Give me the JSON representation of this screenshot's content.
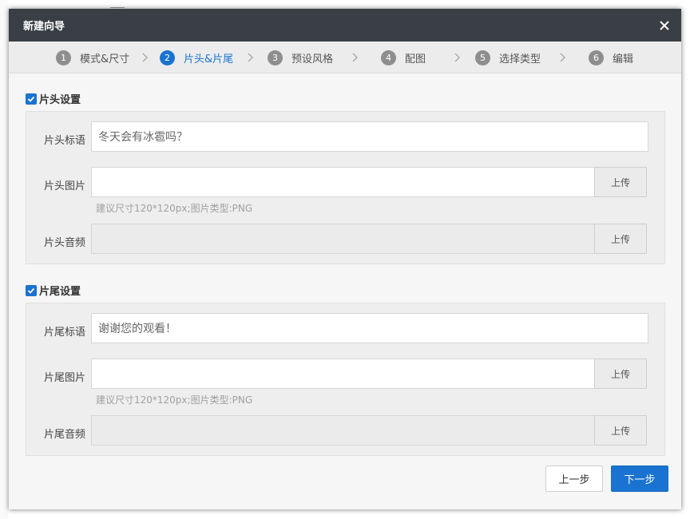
{
  "dialog": {
    "title": "新建向导"
  },
  "steps": [
    {
      "num": "1",
      "label": "模式&尺寸",
      "active": false
    },
    {
      "num": "2",
      "label": "片头&片尾",
      "active": true
    },
    {
      "num": "3",
      "label": "预设风格",
      "active": false
    },
    {
      "num": "4",
      "label": "配图",
      "active": false
    },
    {
      "num": "5",
      "label": "选择类型",
      "active": false
    },
    {
      "num": "6",
      "label": "编辑",
      "active": false
    }
  ],
  "intro": {
    "heading": "片头设置",
    "checked": true,
    "slogan_label": "片头标语",
    "slogan_value": "冬天会有冰雹吗？",
    "image_label": "片头图片",
    "image_value": "",
    "hint": "建议尺寸120*120px;图片类型:PNG",
    "audio_label": "片头音频",
    "audio_value": "",
    "upload_label": "上传"
  },
  "outro": {
    "heading": "片尾设置",
    "checked": true,
    "slogan_label": "片尾标语",
    "slogan_value": "谢谢您的观看！",
    "image_label": "片尾图片",
    "image_value": "",
    "hint": "建议尺寸120*120px;图片类型:PNG",
    "audio_label": "片尾音频",
    "audio_value": "",
    "upload_label": "上传"
  },
  "footer": {
    "prev_label": "上一步",
    "next_label": "下一步"
  },
  "colors": {
    "accent": "#1a73d0",
    "titlebar": "#3a3f45"
  }
}
